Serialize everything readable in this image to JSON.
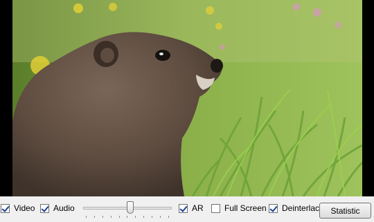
{
  "video": {
    "scene": "marmot-in-grass"
  },
  "controls": {
    "video": {
      "label": "Video",
      "checked": true
    },
    "audio": {
      "label": "Audio",
      "checked": true
    },
    "volume": {
      "level": 0.53
    },
    "ar": {
      "label": "AR",
      "checked": true
    },
    "fullscreen": {
      "label": "Full Screen",
      "checked": false
    },
    "deinterlace": {
      "label": "Deinterlace",
      "checked": true
    },
    "statistic": {
      "label": "Statistic"
    }
  }
}
